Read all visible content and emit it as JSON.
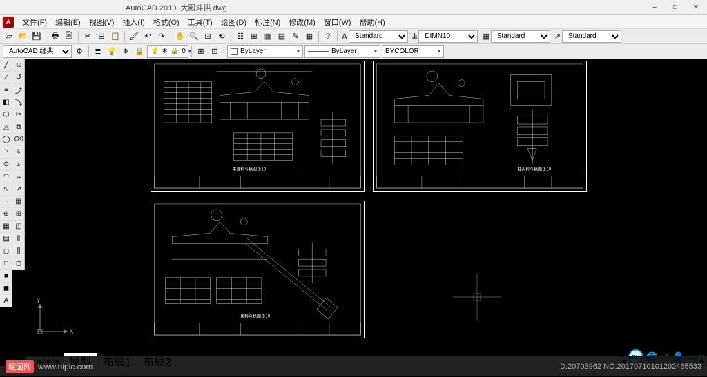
{
  "app": {
    "name": "AutoCAD 2010",
    "file": "大殿斗拱.dwg"
  },
  "menu": [
    "文件(F)",
    "编辑(E)",
    "视图(V)",
    "插入(I)",
    "格式(O)",
    "工具(T)",
    "绘图(D)",
    "标注(N)",
    "修改(M)",
    "窗口(W)",
    "帮助(H)"
  ],
  "workspace_select": "AutoCAD 经典",
  "style_selects": {
    "text": "Standard",
    "dim": "DIMN10",
    "table": "Standard",
    "mls": "Standard"
  },
  "layer_props": {
    "layer": "ByLayer",
    "color": "ByLayer",
    "linetype": "BYCOLOR"
  },
  "tabs": {
    "nav": [
      "◀",
      "▶",
      "|◀",
      "▶|"
    ],
    "items": [
      "模型",
      "布局1",
      "布局2"
    ],
    "active": 0
  },
  "watermark": {
    "site": "昵图网",
    "url": "www.nipic.com",
    "id": "ID:20703962 NO:20170710101202465533"
  },
  "ucs": {
    "x": "X",
    "y": "Y"
  },
  "right_status": {
    "badge": "xPLY"
  },
  "window_controls": {
    "min": "–",
    "max": "□",
    "close": "✕"
  },
  "icons": {
    "left1": [
      "╱",
      "⟋",
      "≡",
      "◧",
      "⬡",
      "△",
      "◯",
      "◝",
      "⊙",
      "◠",
      "∿",
      "~",
      "⊕",
      "▦",
      "▤",
      "◻",
      "□",
      "■",
      "◼",
      "A"
    ],
    "left2": [
      "⎌",
      "↺",
      "⤴",
      "⤵",
      "✂",
      "⧉",
      "⌫",
      "⎀",
      "⫝",
      "↔",
      "↗",
      "▦",
      "⊞",
      "◫",
      "⫴",
      "⫼",
      "◻"
    ]
  }
}
